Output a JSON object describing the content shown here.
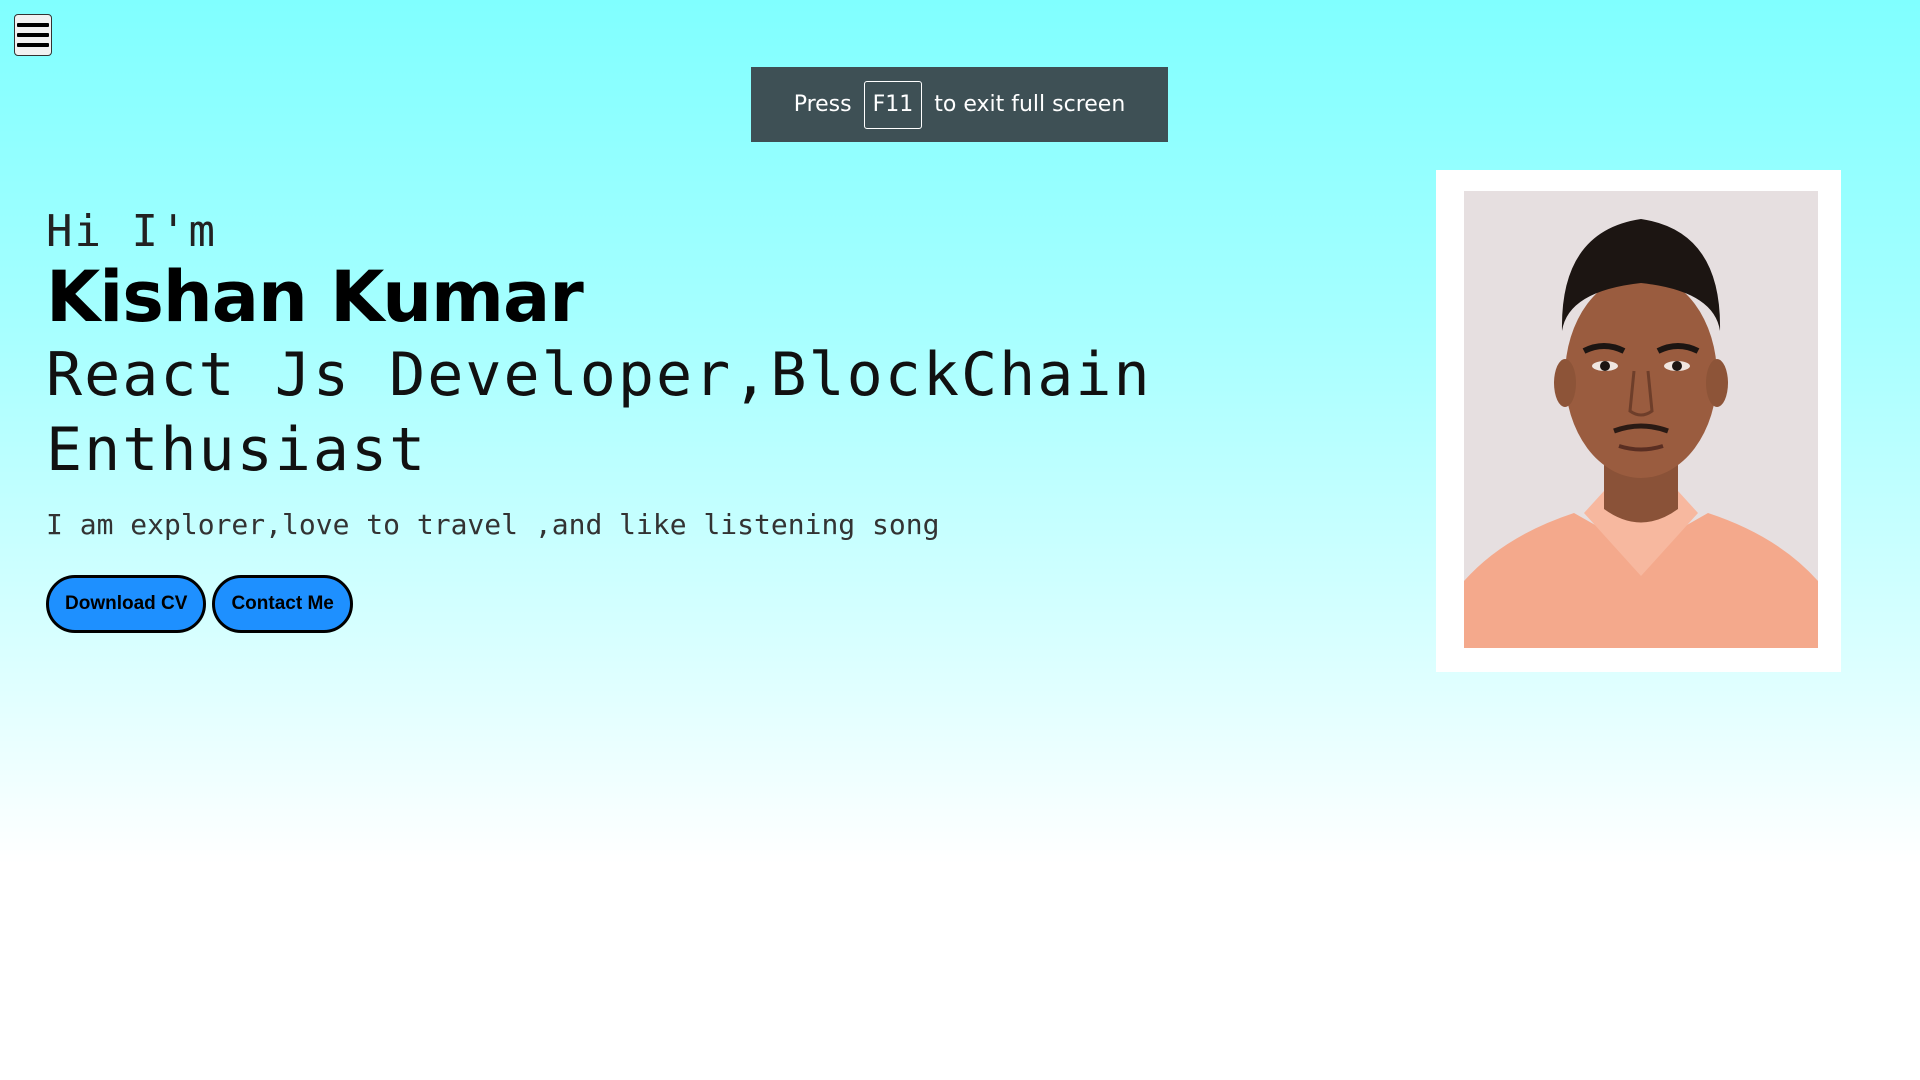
{
  "nav": {
    "menu_icon": "hamburger-menu-icon"
  },
  "fullscreen_toast": {
    "prefix": "Press",
    "key": "F11",
    "suffix": "to exit full screen"
  },
  "hero": {
    "greeting": "Hi I'm",
    "name": "Kishan Kumar",
    "role": "React Js Developer,BlockChain Enthusiast",
    "bio": "I am explorer,love to travel ,and like listening song",
    "buttons": {
      "download_cv": "Download CV",
      "contact_me": "Contact Me"
    }
  },
  "profile_photo": {
    "subject": "portrait-photo"
  },
  "colors": {
    "background_top": "#80ffff",
    "background_bottom": "#ffffff",
    "button_fill": "#1e90ff",
    "toast_bg": "#3e5055"
  }
}
